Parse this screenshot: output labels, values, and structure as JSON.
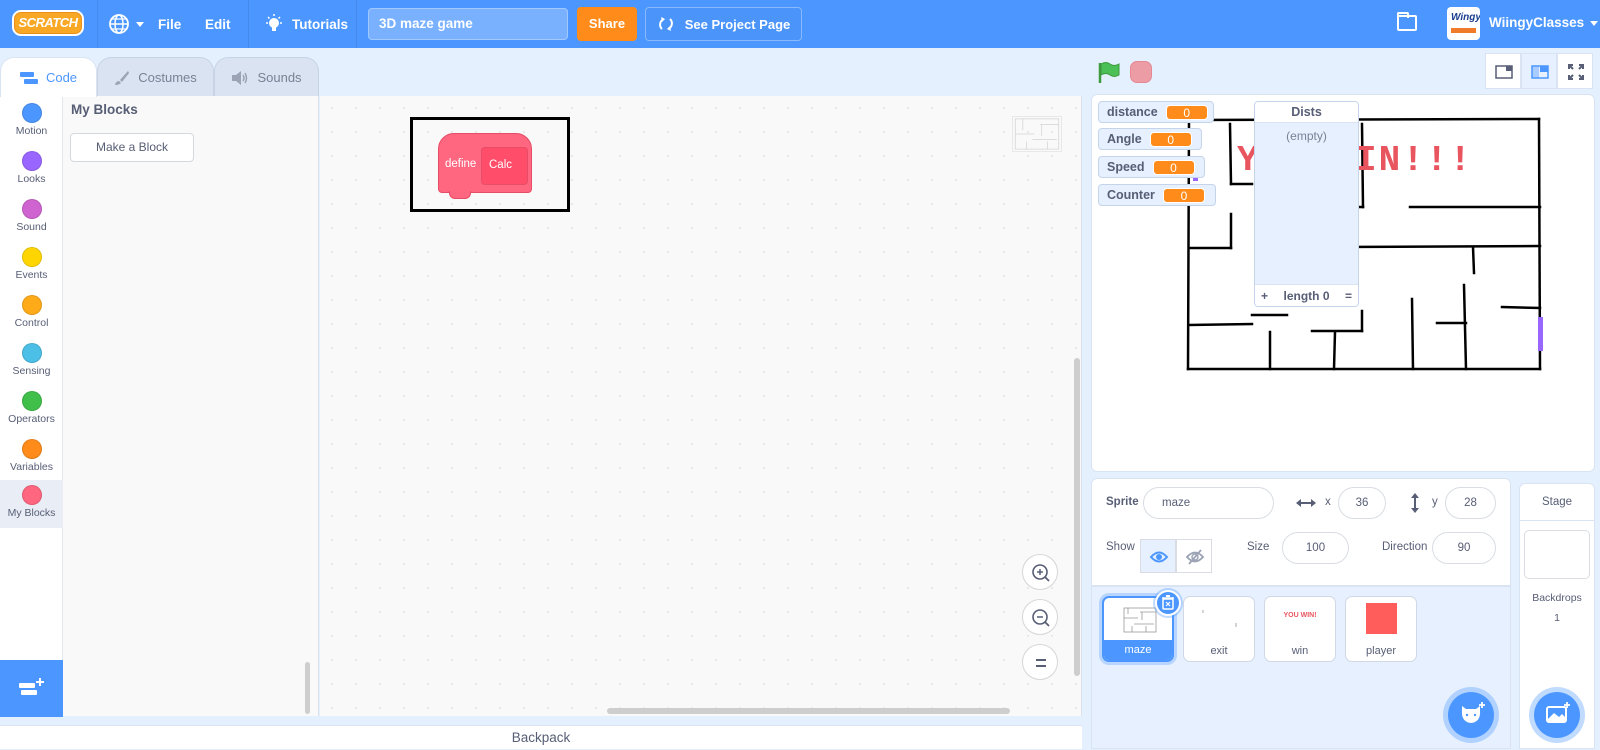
{
  "menubar": {
    "logo": "SCRATCH",
    "language_icon": "globe-icon",
    "file": "File",
    "edit": "Edit",
    "tutorials": "Tutorials",
    "project_title": "3D maze game",
    "share": "Share",
    "see_project_page": "See Project Page",
    "username": "WiingyClasses",
    "avatar_text": "Wingy",
    "accent": "#4c97ff"
  },
  "tabs": [
    {
      "label": "Code",
      "icon": "code-icon",
      "active": true
    },
    {
      "label": "Costumes",
      "icon": "brush-icon",
      "active": false
    },
    {
      "label": "Sounds",
      "icon": "speaker-icon",
      "active": false
    }
  ],
  "categories": [
    {
      "label": "Motion",
      "color": "#4c97ff"
    },
    {
      "label": "Looks",
      "color": "#9966ff"
    },
    {
      "label": "Sound",
      "color": "#cf63cf"
    },
    {
      "label": "Events",
      "color": "#ffd500"
    },
    {
      "label": "Control",
      "color": "#ffab19"
    },
    {
      "label": "Sensing",
      "color": "#4cbfe6"
    },
    {
      "label": "Operators",
      "color": "#40bf4a"
    },
    {
      "label": "Variables",
      "color": "#ff8c1a"
    },
    {
      "label": "My Blocks",
      "color": "#ff6680",
      "selected": true
    }
  ],
  "flyout": {
    "title": "My Blocks",
    "make_block": "Make a Block"
  },
  "workspace": {
    "define_label": "define",
    "block_name": "Calc"
  },
  "backpack": "Backpack",
  "stage": {
    "monitors": [
      {
        "name": "distance",
        "value": "0"
      },
      {
        "name": "Angle",
        "value": "0"
      },
      {
        "name": "Speed",
        "value": "0"
      },
      {
        "name": "Counter",
        "value": "0"
      }
    ],
    "list": {
      "name": "Dists",
      "empty_text": "(empty)",
      "add": "+",
      "length_label": "length 0",
      "resize": "="
    },
    "banner_text": "YOU WIN!!!"
  },
  "sprite_info": {
    "sprite_label": "Sprite",
    "sprite_name": "maze",
    "x_label": "x",
    "x_value": "36",
    "y_label": "y",
    "y_value": "28",
    "show_label": "Show",
    "size_label": "Size",
    "size_value": "100",
    "direction_label": "Direction",
    "direction_value": "90"
  },
  "sprites": [
    {
      "name": "maze",
      "selected": true
    },
    {
      "name": "exit",
      "selected": false
    },
    {
      "name": "win",
      "selected": false,
      "thumb_text": "YOU WIN!"
    },
    {
      "name": "player",
      "selected": false
    }
  ],
  "stage_pane": {
    "title": "Stage",
    "backdrops_label": "Backdrops",
    "backdrops_count": "1"
  }
}
